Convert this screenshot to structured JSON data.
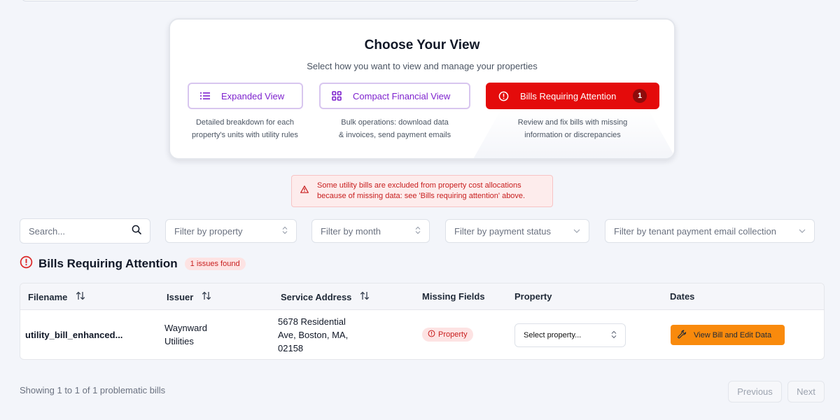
{
  "card": {
    "title": "Choose Your View",
    "subtitle": "Select how you want to view and manage your properties",
    "views": [
      {
        "label": "Expanded View",
        "icon": "list-icon",
        "description_lines": [
          "Detailed breakdown for each",
          "property's units with utility rules"
        ]
      },
      {
        "label": "Compact Financial View",
        "icon": "grid-icon",
        "description_lines": [
          "Bulk operations: download data",
          "& invoices, send payment emails"
        ]
      },
      {
        "label": "Bills Requiring Attention",
        "icon": "alert-circle-icon",
        "count": "1",
        "active": true,
        "description_lines": [
          "Review and fix bills with missing",
          "information or discrepancies"
        ]
      }
    ]
  },
  "alert": {
    "lines": [
      "Some utility bills are excluded from property cost allocations",
      "because of missing data: see 'Bills requiring attention' above."
    ]
  },
  "filters": {
    "search_placeholder": "Search...",
    "property": "Filter by property",
    "month": "Filter by month",
    "payment_status": "Filter by payment status",
    "email_collection": "Filter by tenant payment email collection"
  },
  "section": {
    "title": "Bills Requiring Attention",
    "badge": "1 issues found"
  },
  "table": {
    "headers": [
      "Filename",
      "Issuer",
      "Service Address",
      "Missing Fields",
      "Property",
      "Dates"
    ],
    "rows": [
      {
        "filename": "utility_bill_enhanced...",
        "issuer_lines": [
          "Waynward",
          "Utilities"
        ],
        "address_lines": [
          "5678 Residential",
          "Ave, Boston, MA,",
          "02158"
        ],
        "missing_field": "Property",
        "property_select": "Select property...",
        "action": "View Bill and Edit Data"
      }
    ]
  },
  "footer": {
    "summary": "Showing 1 to 1 of 1 problematic bills",
    "previous": "Previous",
    "next": "Next"
  },
  "colors": {
    "accent_purple": "#7e22ce",
    "danger_red": "#e40b0b",
    "action_orange": "#f98a0c"
  }
}
